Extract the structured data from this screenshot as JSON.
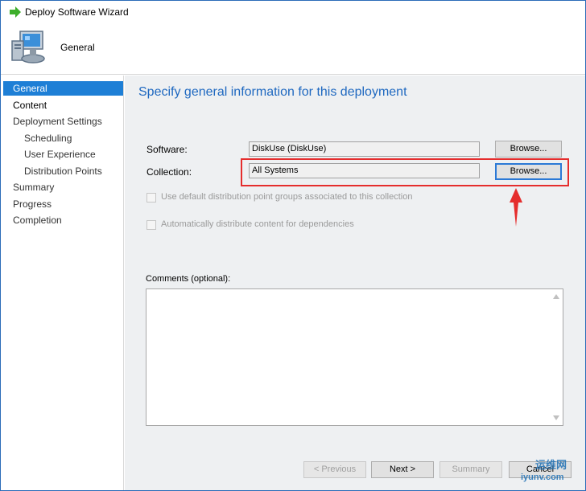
{
  "window": {
    "title": "Deploy Software Wizard"
  },
  "header": {
    "page_title": "General"
  },
  "sidebar": {
    "items": [
      {
        "label": "General",
        "selected": true
      },
      {
        "label": "Content"
      },
      {
        "label": "Deployment Settings"
      },
      {
        "label": "Scheduling"
      },
      {
        "label": "User Experience"
      },
      {
        "label": "Distribution Points"
      },
      {
        "label": "Summary"
      },
      {
        "label": "Progress"
      },
      {
        "label": "Completion"
      }
    ]
  },
  "main": {
    "heading": "Specify general information for this deployment",
    "software": {
      "label": "Software:",
      "value": "DiskUse (DiskUse)",
      "browse": "Browse..."
    },
    "collection": {
      "label": "Collection:",
      "value": "All Systems",
      "browse": "Browse..."
    },
    "checkbox_default_groups": "Use default distribution point groups associated to this collection",
    "checkbox_dependencies": "Automatically distribute content for dependencies",
    "comments_label": "Comments (optional):",
    "comments_value": ""
  },
  "footer": {
    "previous": "< Previous",
    "next": "Next >",
    "summary": "Summary",
    "cancel": "Cancel"
  },
  "watermark": {
    "text": "运维网",
    "sub": "iyunv.com"
  },
  "colors": {
    "accent": "#1e7fd6",
    "heading": "#1e68c0",
    "annotation": "#e52d2d"
  }
}
